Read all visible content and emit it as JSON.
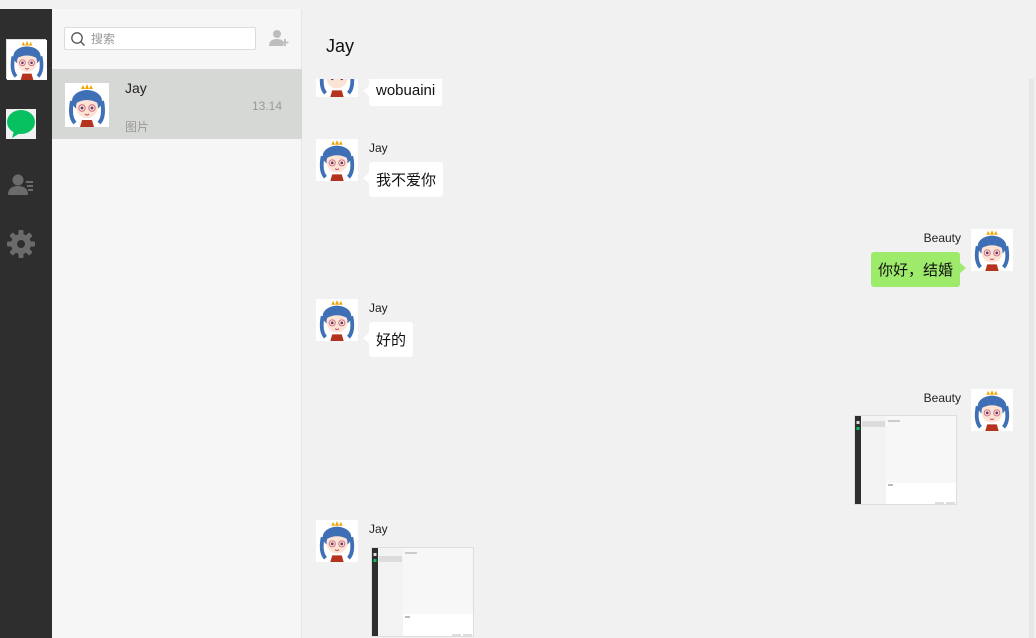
{
  "nav": {
    "items": [
      {
        "name": "chat",
        "color": "#07c160"
      },
      {
        "name": "contacts",
        "color": "#6b6b6b"
      },
      {
        "name": "settings",
        "color": "#6b6b6b"
      }
    ]
  },
  "search": {
    "placeholder": "搜索"
  },
  "sessions": [
    {
      "name": "Jay",
      "time": "13.14",
      "preview": "图片"
    }
  ],
  "chat": {
    "title": "Jay",
    "messages": [
      {
        "side": "left",
        "sender": "",
        "type": "text",
        "text": "wobuaini"
      },
      {
        "side": "left",
        "sender": "Jay",
        "type": "text",
        "text": "我不爱你"
      },
      {
        "side": "right",
        "sender": "Beauty",
        "type": "text",
        "text": "你好，结婚"
      },
      {
        "side": "left",
        "sender": "Jay",
        "type": "text",
        "text": "好的"
      },
      {
        "side": "right",
        "sender": "Beauty",
        "type": "image",
        "text": ""
      },
      {
        "side": "left",
        "sender": "Jay",
        "type": "image",
        "text": ""
      }
    ]
  },
  "colors": {
    "nav_bg": "#2e2e2e",
    "list_bg": "#f6f6f6",
    "selected_session": "#d6d8d5",
    "chat_bg": "#f1f1f1",
    "bubble_self": "#9eea6a",
    "bubble_other": "#ffffff",
    "accent": "#07c160"
  }
}
